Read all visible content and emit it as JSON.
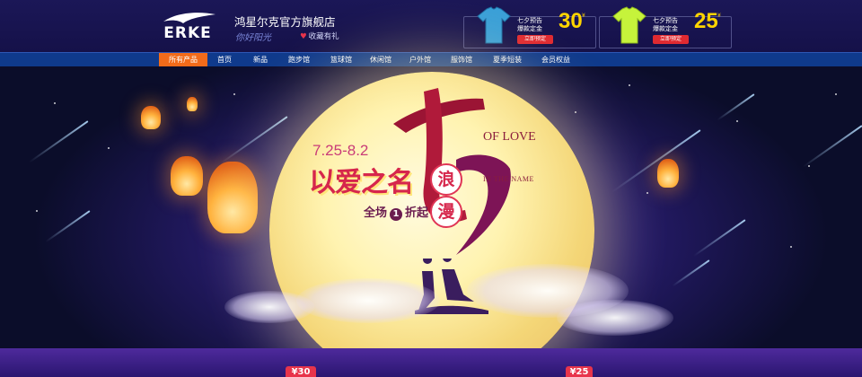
{
  "header": {
    "brand_logo_text": "ERKE",
    "store_name": "鸿星尔克官方旗舰店",
    "slogan": "你好阳光",
    "favorite_label": "收藏有礼"
  },
  "promos": [
    {
      "color": "#3aa0d8",
      "line1": "七夕预告",
      "line2": "爆款定金",
      "price": "30",
      "currency": "¥",
      "button": "立即预定"
    },
    {
      "color": "#c6f33b",
      "line1": "七夕预告",
      "line2": "爆款定金",
      "price": "25",
      "currency": "¥",
      "button": "立即预定"
    }
  ],
  "nav": {
    "items": [
      "所有产品",
      "首页",
      "新品",
      "跑步馆",
      "篮球馆",
      "休闲馆",
      "户外馆",
      "服饰馆",
      "夏季短装",
      "会员权益"
    ],
    "active_index": 0
  },
  "banner": {
    "date_range": "7.25-8.2",
    "headline": "以爱之名",
    "word_lang": "浪",
    "word_man": "漫",
    "sale_prefix": "全场",
    "sale_number": "1",
    "sale_suffix": "折起",
    "english_line1": "IN THE NAME",
    "english_line2": "OF LOVE",
    "big_glyph": "七夕"
  },
  "bottom_tags": [
    "¥30",
    "¥25"
  ]
}
